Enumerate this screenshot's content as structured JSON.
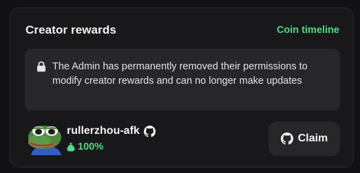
{
  "card": {
    "title": "Creator rewards",
    "timeline_link": "Coin timeline"
  },
  "notice": {
    "icon": "lock-icon",
    "text": "The Admin has permanently removed their permissions to modify creator rewards and can no longer make updates"
  },
  "creator": {
    "avatar": "pepe-frog-avatar",
    "username": "rullerzhou-afk",
    "platform_icon": "github-icon",
    "share_icon": "money-bag-icon",
    "share": "100%"
  },
  "claim_button": {
    "icon": "github-icon",
    "label": "Claim"
  },
  "colors": {
    "accent_green": "#4ade80",
    "card_bg": "#18181b",
    "panel_bg": "#27272a"
  }
}
